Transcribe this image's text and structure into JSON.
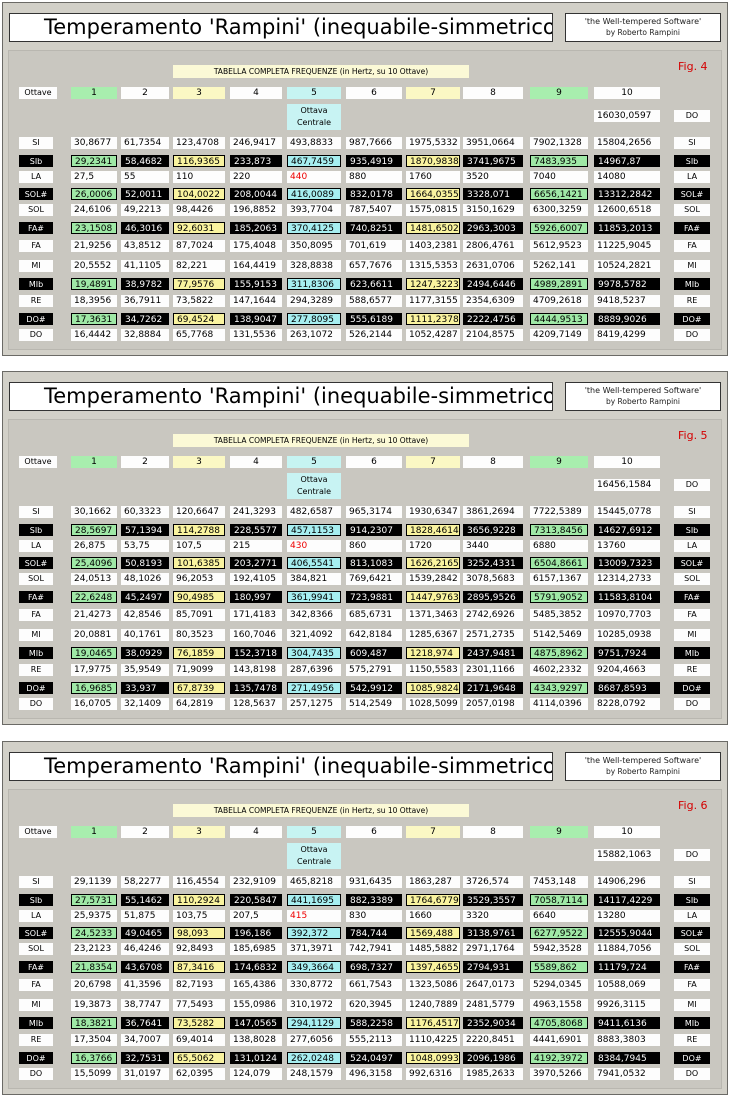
{
  "panels": [
    {
      "title": "Temperamento 'Rampini' (inequabile-simmetrico)",
      "brand_line1": "'the Well-tempered Software'",
      "brand_line2": "by Roberto Rampini",
      "table_title": "TABELLA COMPLETA FREQUENZE (in Hertz, su 10 Ottave)",
      "fig": "Fig. 4",
      "octave_label": "Ottave",
      "octaves": [
        "1",
        "2",
        "3",
        "4",
        "5",
        "6",
        "7",
        "8",
        "9",
        "10"
      ],
      "central_line1": "Ottava",
      "central_line2": "Centrale",
      "top_do": "16030,0597",
      "rows": [
        {
          "note": "SI",
          "black": false,
          "v": [
            "30,8677",
            "61,7354",
            "123,4708",
            "246,9417",
            "493,8833",
            "987,7666",
            "1975,5332",
            "3951,0664",
            "7902,1328",
            "15804,2656"
          ]
        },
        {
          "note": "SIb",
          "black": true,
          "v": [
            "29,2341",
            "58,4682",
            "116,9365",
            "233,873",
            "467,7459",
            "935,4919",
            "1870,9838",
            "3741,9675",
            "7483,935",
            "14967,87"
          ]
        },
        {
          "note": "LA",
          "black": false,
          "v": [
            "27,5",
            "55",
            "110",
            "220",
            "440",
            "880",
            "1760",
            "3520",
            "7040",
            "14080"
          ]
        },
        {
          "note": "SOL#",
          "black": true,
          "v": [
            "26,0006",
            "52,0011",
            "104,0022",
            "208,0044",
            "416,0089",
            "832,0178",
            "1664,0355",
            "3328,071",
            "6656,1421",
            "13312,2842"
          ]
        },
        {
          "note": "SOL",
          "black": false,
          "v": [
            "24,6106",
            "49,2213",
            "98,4426",
            "196,8852",
            "393,7704",
            "787,5407",
            "1575,0815",
            "3150,1629",
            "6300,3259",
            "12600,6518"
          ]
        },
        {
          "note": "FA#",
          "black": true,
          "v": [
            "23,1508",
            "46,3016",
            "92,6031",
            "185,2063",
            "370,4125",
            "740,8251",
            "1481,6502",
            "2963,3003",
            "5926,6007",
            "11853,2013"
          ]
        },
        {
          "note": "FA",
          "black": false,
          "v": [
            "21,9256",
            "43,8512",
            "87,7024",
            "175,4048",
            "350,8095",
            "701,619",
            "1403,2381",
            "2806,4761",
            "5612,9523",
            "11225,9045"
          ]
        },
        {
          "note": "MI",
          "black": false,
          "v": [
            "20,5552",
            "41,1105",
            "82,221",
            "164,4419",
            "328,8838",
            "657,7676",
            "1315,5353",
            "2631,0706",
            "5262,141",
            "10524,2821"
          ]
        },
        {
          "note": "MIb",
          "black": true,
          "v": [
            "19,4891",
            "38,9782",
            "77,9576",
            "155,9153",
            "311,8306",
            "623,6611",
            "1247,3223",
            "2494,6446",
            "4989,2891",
            "9978,5782"
          ]
        },
        {
          "note": "RE",
          "black": false,
          "v": [
            "18,3956",
            "36,7911",
            "73,5822",
            "147,1644",
            "294,3289",
            "588,6577",
            "1177,3155",
            "2354,6309",
            "4709,2618",
            "9418,5237"
          ]
        },
        {
          "note": "DO#",
          "black": true,
          "v": [
            "17,3631",
            "34,7262",
            "69,4524",
            "138,9047",
            "277,8095",
            "555,6189",
            "1111,2378",
            "2222,4756",
            "4444,9513",
            "8889,9026"
          ]
        },
        {
          "note": "DO",
          "black": false,
          "v": [
            "16,4442",
            "32,8884",
            "65,7768",
            "131,5536",
            "263,1072",
            "526,2144",
            "1052,4287",
            "2104,8575",
            "4209,7149",
            "8419,4299"
          ]
        }
      ]
    },
    {
      "title": "Temperamento 'Rampini' (inequabile-simmetrico)",
      "brand_line1": "'the Well-tempered Software'",
      "brand_line2": "by Roberto Rampini",
      "table_title": "TABELLA COMPLETA FREQUENZE (in Hertz, su 10 Ottave)",
      "fig": "Fig. 5",
      "octave_label": "Ottave",
      "octaves": [
        "1",
        "2",
        "3",
        "4",
        "5",
        "6",
        "7",
        "8",
        "9",
        "10"
      ],
      "central_line1": "Ottava",
      "central_line2": "Centrale",
      "top_do": "16456,1584",
      "rows": [
        {
          "note": "SI",
          "black": false,
          "v": [
            "30,1662",
            "60,3323",
            "120,6647",
            "241,3293",
            "482,6587",
            "965,3174",
            "1930,6347",
            "3861,2694",
            "7722,5389",
            "15445,0778"
          ]
        },
        {
          "note": "SIb",
          "black": true,
          "v": [
            "28,5697",
            "57,1394",
            "114,2788",
            "228,5577",
            "457,1153",
            "914,2307",
            "1828,4614",
            "3656,9228",
            "7313,8456",
            "14627,6912"
          ]
        },
        {
          "note": "LA",
          "black": false,
          "v": [
            "26,875",
            "53,75",
            "107,5",
            "215",
            "430",
            "860",
            "1720",
            "3440",
            "6880",
            "13760"
          ]
        },
        {
          "note": "SOL#",
          "black": true,
          "v": [
            "25,4096",
            "50,8193",
            "101,6385",
            "203,2771",
            "406,5541",
            "813,1083",
            "1626,2165",
            "3252,4331",
            "6504,8661",
            "13009,7323"
          ]
        },
        {
          "note": "SOL",
          "black": false,
          "v": [
            "24,0513",
            "48,1026",
            "96,2053",
            "192,4105",
            "384,821",
            "769,6421",
            "1539,2842",
            "3078,5683",
            "6157,1367",
            "12314,2733"
          ]
        },
        {
          "note": "FA#",
          "black": true,
          "v": [
            "22,6248",
            "45,2497",
            "90,4985",
            "180,997",
            "361,9941",
            "723,9881",
            "1447,9763",
            "2895,9526",
            "5791,9052",
            "11583,8104"
          ]
        },
        {
          "note": "FA",
          "black": false,
          "v": [
            "21,4273",
            "42,8546",
            "85,7091",
            "171,4183",
            "342,8366",
            "685,6731",
            "1371,3463",
            "2742,6926",
            "5485,3852",
            "10970,7703"
          ]
        },
        {
          "note": "MI",
          "black": false,
          "v": [
            "20,0881",
            "40,1761",
            "80,3523",
            "160,7046",
            "321,4092",
            "642,8184",
            "1285,6367",
            "2571,2735",
            "5142,5469",
            "10285,0938"
          ]
        },
        {
          "note": "MIb",
          "black": true,
          "v": [
            "19,0465",
            "38,0929",
            "76,1859",
            "152,3718",
            "304,7435",
            "609,487",
            "1218,974",
            "2437,9481",
            "4875,8962",
            "9751,7924"
          ]
        },
        {
          "note": "RE",
          "black": false,
          "v": [
            "17,9775",
            "35,9549",
            "71,9099",
            "143,8198",
            "287,6396",
            "575,2791",
            "1150,5583",
            "2301,1166",
            "4602,2332",
            "9204,4663"
          ]
        },
        {
          "note": "DO#",
          "black": true,
          "v": [
            "16,9685",
            "33,937",
            "67,8739",
            "135,7478",
            "271,4956",
            "542,9912",
            "1085,9824",
            "2171,9648",
            "4343,9297",
            "8687,8593"
          ]
        },
        {
          "note": "DO",
          "black": false,
          "v": [
            "16,0705",
            "32,1409",
            "64,2819",
            "128,5637",
            "257,1275",
            "514,2549",
            "1028,5099",
            "2057,0198",
            "4114,0396",
            "8228,0792"
          ]
        }
      ]
    },
    {
      "title": "Temperamento 'Rampini' (inequabile-simmetrico)",
      "brand_line1": "'the Well-tempered Software'",
      "brand_line2": "by Roberto Rampini",
      "table_title": "TABELLA COMPLETA FREQUENZE (in Hertz, su 10 Ottave)",
      "fig": "Fig. 6",
      "octave_label": "Ottave",
      "octaves": [
        "1",
        "2",
        "3",
        "4",
        "5",
        "6",
        "7",
        "8",
        "9",
        "10"
      ],
      "central_line1": "Ottava",
      "central_line2": "Centrale",
      "top_do": "15882,1063",
      "rows": [
        {
          "note": "SI",
          "black": false,
          "v": [
            "29,1139",
            "58,2277",
            "116,4554",
            "232,9109",
            "465,8218",
            "931,6435",
            "1863,287",
            "3726,574",
            "7453,148",
            "14906,296"
          ]
        },
        {
          "note": "SIb",
          "black": true,
          "v": [
            "27,5731",
            "55,1462",
            "110,2924",
            "220,5847",
            "441,1695",
            "882,3389",
            "1764,6779",
            "3529,3557",
            "7058,7114",
            "14117,4229"
          ]
        },
        {
          "note": "LA",
          "black": false,
          "v": [
            "25,9375",
            "51,875",
            "103,75",
            "207,5",
            "415",
            "830",
            "1660",
            "3320",
            "6640",
            "13280"
          ]
        },
        {
          "note": "SOL#",
          "black": true,
          "v": [
            "24,5233",
            "49,0465",
            "98,093",
            "196,186",
            "392,372",
            "784,744",
            "1569,488",
            "3138,9761",
            "6277,9522",
            "12555,9044"
          ]
        },
        {
          "note": "SOL",
          "black": false,
          "v": [
            "23,2123",
            "46,4246",
            "92,8493",
            "185,6985",
            "371,3971",
            "742,7941",
            "1485,5882",
            "2971,1764",
            "5942,3528",
            "11884,7056"
          ]
        },
        {
          "note": "FA#",
          "black": true,
          "v": [
            "21,8354",
            "43,6708",
            "87,3416",
            "174,6832",
            "349,3664",
            "698,7327",
            "1397,4655",
            "2794,931",
            "5589,862",
            "11179,724"
          ]
        },
        {
          "note": "FA",
          "black": false,
          "v": [
            "20,6798",
            "41,3596",
            "82,7193",
            "165,4386",
            "330,8772",
            "661,7543",
            "1323,5086",
            "2647,0173",
            "5294,0345",
            "10588,069"
          ]
        },
        {
          "note": "MI",
          "black": false,
          "v": [
            "19,3873",
            "38,7747",
            "77,5493",
            "155,0986",
            "310,1972",
            "620,3945",
            "1240,7889",
            "2481,5779",
            "4963,1558",
            "9926,3115"
          ]
        },
        {
          "note": "MIb",
          "black": true,
          "v": [
            "18,3821",
            "36,7641",
            "73,5282",
            "147,0565",
            "294,1129",
            "588,2258",
            "1176,4517",
            "2352,9034",
            "4705,8068",
            "9411,6136"
          ]
        },
        {
          "note": "RE",
          "black": false,
          "v": [
            "17,3504",
            "34,7007",
            "69,4014",
            "138,8028",
            "277,6056",
            "555,2113",
            "1110,4225",
            "2220,8451",
            "4441,6901",
            "8883,3803"
          ]
        },
        {
          "note": "DO#",
          "black": true,
          "v": [
            "16,3766",
            "32,7531",
            "65,5062",
            "131,0124",
            "262,0248",
            "524,0497",
            "1048,0993",
            "2096,1986",
            "4192,3972",
            "8384,7945"
          ]
        },
        {
          "note": "DO",
          "black": false,
          "v": [
            "15,5099",
            "31,0197",
            "62,0395",
            "124,079",
            "248,1579",
            "496,3158",
            "992,6316",
            "1985,2633",
            "3970,5266",
            "7941,0532"
          ]
        }
      ]
    }
  ]
}
